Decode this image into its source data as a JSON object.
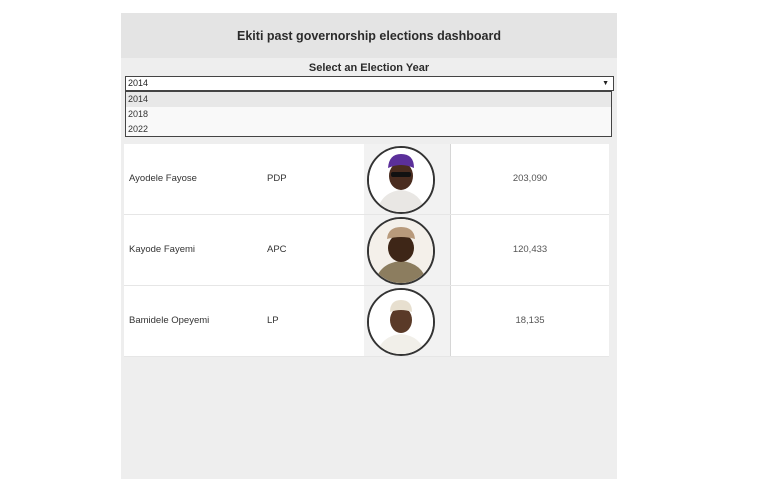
{
  "dashboard": {
    "title": "Ekiti past governorship elections dashboard",
    "filter_label": "Select an Election Year",
    "selected_year": "2014",
    "year_options": [
      "2014",
      "2018",
      "2022"
    ]
  },
  "candidates": [
    {
      "name": "Ayodele Fayose",
      "party": "PDP",
      "votes": "203,090",
      "cap_color": "#5b2f9a",
      "face_color": "#4a2c1f",
      "robe_color": "#e9e7e4"
    },
    {
      "name": "Kayode Fayemi",
      "party": "APC",
      "votes": "120,433",
      "cap_color": "#b89a7b",
      "face_color": "#3e2617",
      "robe_color": "#8c7d5f"
    },
    {
      "name": "Bamidele Opeyemi",
      "party": "LP",
      "votes": "18,135",
      "cap_color": "#e7dfcf",
      "face_color": "#5a3a28",
      "robe_color": "#f1efe9"
    }
  ]
}
